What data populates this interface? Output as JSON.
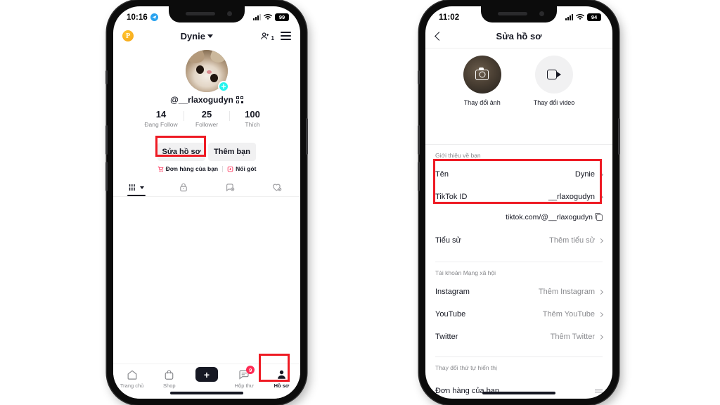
{
  "left_phone": {
    "status_bar": {
      "time": "10:16",
      "telegram_icon": "telegram-icon",
      "battery": "99"
    },
    "header": {
      "coin_badge": "P",
      "username": "Dynie",
      "dropdown_icon": "chevron-down-icon",
      "add_friend_icon": "add-friend-icon",
      "add_friend_count": "1",
      "menu_icon": "hamburger-menu-icon"
    },
    "profile": {
      "avatar": "profile-avatar",
      "add_badge": "+",
      "handle": "@__rlaxogudyn",
      "qr_icon": "qr-code-icon"
    },
    "stats": [
      {
        "value": "14",
        "label": "Đang Follow"
      },
      {
        "value": "25",
        "label": "Follower"
      },
      {
        "value": "100",
        "label": "Thích"
      }
    ],
    "buttons": [
      {
        "label": "Sửa hồ sơ"
      },
      {
        "label": "Thêm bạn"
      }
    ],
    "mini_links": [
      {
        "icon": "cart-icon",
        "label": "Đơn hàng của bạn"
      },
      {
        "icon": "add-box-icon",
        "label": "Nối gót"
      }
    ],
    "tabs": [
      {
        "icon": "grid-icon",
        "active": true
      },
      {
        "icon": "lock-icon",
        "active": false
      },
      {
        "icon": "repost-icon",
        "active": false
      },
      {
        "icon": "heart-icon",
        "active": false
      }
    ],
    "tabbar": [
      {
        "icon": "home-icon",
        "label": "Trang chủ",
        "active": false
      },
      {
        "icon": "shop-bag-icon",
        "label": "Shop",
        "active": false
      },
      {
        "icon": "create-plus-icon",
        "label": "",
        "active": false
      },
      {
        "icon": "inbox-icon",
        "label": "Hộp thư",
        "active": false,
        "badge": "9"
      },
      {
        "icon": "profile-person-icon",
        "label": "Hồ sơ",
        "active": true
      }
    ]
  },
  "right_phone": {
    "status_bar": {
      "time": "11:02",
      "battery": "94"
    },
    "nav": {
      "back_icon": "back-chevron-icon",
      "title": "Sửa hồ sơ"
    },
    "media": [
      {
        "icon": "camera-icon",
        "label": "Thay đổi ảnh"
      },
      {
        "icon": "video-camera-icon",
        "label": "Thay đổi video"
      }
    ],
    "section_about": {
      "label": "Giới thiệu về bạn"
    },
    "about_rows": [
      {
        "key": "Tên",
        "value": "Dynie",
        "muted": false
      },
      {
        "key": "TikTok ID",
        "value": "__rlaxogudyn",
        "muted": false
      }
    ],
    "url_row": {
      "url": "tiktok.com/@__rlaxogudyn",
      "copy_icon": "copy-icon"
    },
    "bio_row": {
      "key": "Tiểu sử",
      "value": "Thêm tiểu sử",
      "muted": true
    },
    "section_social": {
      "label": "Tài khoản Mạng xã hội"
    },
    "social_rows": [
      {
        "key": "Instagram",
        "value": "Thêm Instagram",
        "muted": true
      },
      {
        "key": "YouTube",
        "value": "Thêm YouTube",
        "muted": true
      },
      {
        "key": "Twitter",
        "value": "Thêm Twitter",
        "muted": true
      }
    ],
    "section_order": {
      "label": "Thay đổi thứ tự hiển thị"
    },
    "order_rows": [
      {
        "key": "Đơn hàng của bạn",
        "handle_icon": "drag-handle-icon"
      }
    ]
  },
  "colors": {
    "annotation_red": "#EE1B24",
    "tiktok_pink": "#FE2C55",
    "tiktok_cyan": "#25F4EE",
    "coin_orange": "#F5A314",
    "text_primary": "#161823",
    "text_muted": "#86878B"
  }
}
